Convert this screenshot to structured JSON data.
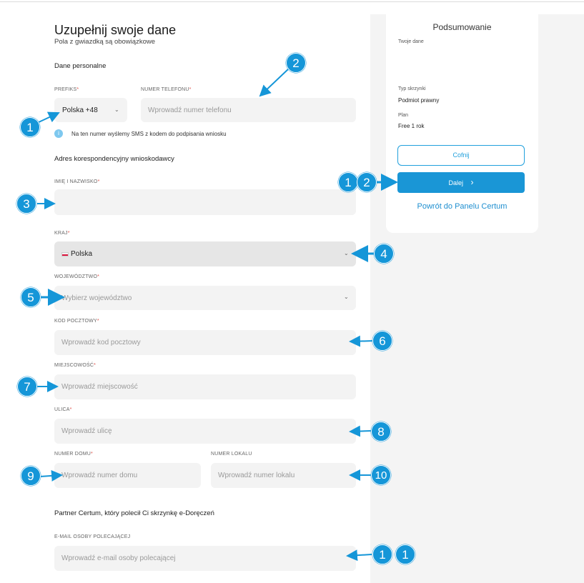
{
  "page": {
    "title": "Uzupełnij swoje dane",
    "subtitle": "Pola z gwiazdką są obowiązkowe",
    "required_marker": "*"
  },
  "personal": {
    "section_title": "Dane personalne",
    "prefix_label": "PREFIKS",
    "prefix_value": "Polska +48",
    "phone_label": "NUMER TELEFONU",
    "phone_placeholder": "Wprowadź numer telefonu",
    "sms_info": "Na ten numer wyślemy SMS z kodem do podpisania wniosku"
  },
  "address": {
    "section_title": "Adres korespondencyjny wnioskodawcy",
    "name_label": "IMIĘ I NAZWISKO",
    "name_value": "",
    "country_label": "KRAJ",
    "country_value": "Polska",
    "voivodeship_label": "WOJEWÓDZTWO",
    "voivodeship_placeholder": "Wybierz województwo",
    "postal_label": "KOD POCZTOWY",
    "postal_placeholder": "Wprowadź kod pocztowy",
    "city_label": "MIEJSCOWOŚĆ",
    "city_placeholder": "Wprowadź miejscowość",
    "street_label": "ULICA",
    "street_placeholder": "Wprowadź ulicę",
    "house_label": "NUMER DOMU",
    "house_placeholder": "Wprowadź numer domu",
    "flat_label": "NUMER LOKALU",
    "flat_placeholder": "Wprowadź numer lokalu"
  },
  "partner": {
    "section_title": "Partner Certum, który polecił Ci skrzynkę e-Doręczeń",
    "email_label": "E-MAIL OSOBY POLECAJĄCEJ",
    "email_placeholder": "Wprowadź e-mail osoby polecającej"
  },
  "summary": {
    "title": "Podsumowanie",
    "your_data_label": "Twoje dane",
    "box_type_label": "Typ skrzynki",
    "box_type_value": "Podmiot prawny",
    "plan_label": "Plan",
    "plan_value": "Free 1 rok",
    "back_button": "Cofnij",
    "next_button": "Dalej",
    "panel_link": "Powrót do Panelu Certum"
  },
  "markers": [
    "1",
    "2",
    "3",
    "4",
    "5",
    "6",
    "7",
    "8",
    "9",
    "10",
    "1",
    "2",
    "1",
    "1"
  ],
  "colors": {
    "accent": "#1596d8",
    "button": "#1a96d6",
    "required": "#e0524b",
    "field": "#f3f3f3"
  },
  "icons": {
    "select": "chevron-down-icon",
    "info": "info-icon",
    "next": "chevron-right-icon",
    "flag": "poland-flag-icon"
  }
}
